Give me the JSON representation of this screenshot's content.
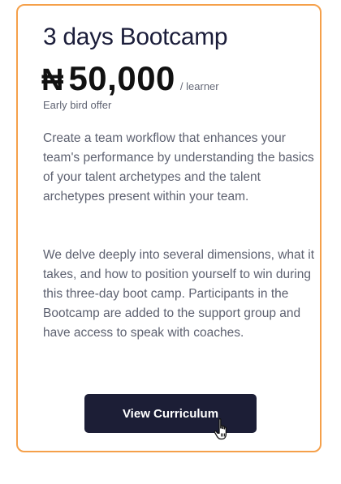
{
  "card": {
    "title": "3 days Bootcamp",
    "price": {
      "currency_symbol": "₦",
      "amount": "50,000",
      "unit": "/ learner"
    },
    "offer_note": "Early bird offer",
    "description": [
      "Create a team workflow that enhances your team's performance by understanding the basics of your talent archetypes and the talent archetypes present within your team.",
      "We delve deeply into several dimensions, what it takes, and how to position yourself to win during this three-day boot camp. Participants in the Bootcamp are added to the support group and have access to speak with coaches."
    ],
    "cta_label": "View Curriculum",
    "accent_color": "#f5a04a",
    "button_color": "#1c1e36"
  },
  "cursor": {
    "icon": "hand-pointer-icon"
  }
}
